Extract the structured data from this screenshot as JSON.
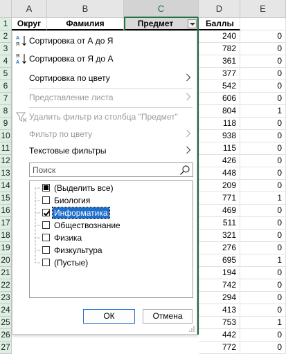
{
  "sheet": {
    "columns": [
      "A",
      "B",
      "C",
      "D",
      "E"
    ],
    "row_numbers": [
      "1",
      "2",
      "3",
      "4",
      "5",
      "6",
      "7",
      "8",
      "9",
      "10",
      "11",
      "12",
      "13",
      "14",
      "15",
      "16",
      "17",
      "18",
      "19",
      "20",
      "21",
      "22",
      "23",
      "24",
      "25",
      "26",
      "27"
    ],
    "headers": {
      "a": "Округ",
      "b": "Фамилия",
      "c": "Предмет",
      "d": "Баллы"
    },
    "d_values": [
      "240",
      "782",
      "361",
      "377",
      "542",
      "606",
      "804",
      "118",
      "938",
      "115",
      "426",
      "448",
      "209",
      "771",
      "469",
      "511",
      "321",
      "276",
      "695",
      "194",
      "742",
      "294",
      "413",
      "753",
      "442",
      "772"
    ],
    "e_values": [
      "0",
      "0",
      "0",
      "0",
      "0",
      "0",
      "1",
      "0",
      "0",
      "0",
      "0",
      "0",
      "0",
      "1",
      "0",
      "0",
      "0",
      "0",
      "1",
      "0",
      "0",
      "0",
      "0",
      "1",
      "0",
      "0"
    ]
  },
  "menu": {
    "sort_asc": "Сортировка от А до Я",
    "sort_desc": "Сортировка от Я до А",
    "sort_by_color": "Сортировка по цвету",
    "sheet_view": "Представление листа",
    "clear_filter": "Удалить фильтр из столбца \"Предмет\"",
    "filter_by_color": "Фильтр по цвету",
    "text_filters": "Текстовые фильтры"
  },
  "search": {
    "placeholder": "Поиск"
  },
  "list": {
    "items": [
      {
        "label": "(Выделить все)",
        "state": "mixed"
      },
      {
        "label": "Биология",
        "state": "unchecked"
      },
      {
        "label": "Информатика",
        "state": "checked"
      },
      {
        "label": "Обществознание",
        "state": "unchecked"
      },
      {
        "label": "Физика",
        "state": "unchecked"
      },
      {
        "label": "Физкультура",
        "state": "unchecked"
      },
      {
        "label": "(Пустые)",
        "state": "unchecked"
      }
    ]
  },
  "buttons": {
    "ok": "ОК",
    "cancel": "Отмена"
  },
  "colors": {
    "accent_green": "#217346",
    "selection_blue": "#1e6ecb",
    "row_header_bg": "#dcefe1"
  },
  "icons": {
    "sort_asc": "sort-ascending-icon",
    "sort_desc": "sort-descending-icon",
    "clear_filter": "clear-filter-icon",
    "search": "search-icon",
    "submenu": "chevron-right-icon",
    "resize": "resize-grip-icon"
  }
}
